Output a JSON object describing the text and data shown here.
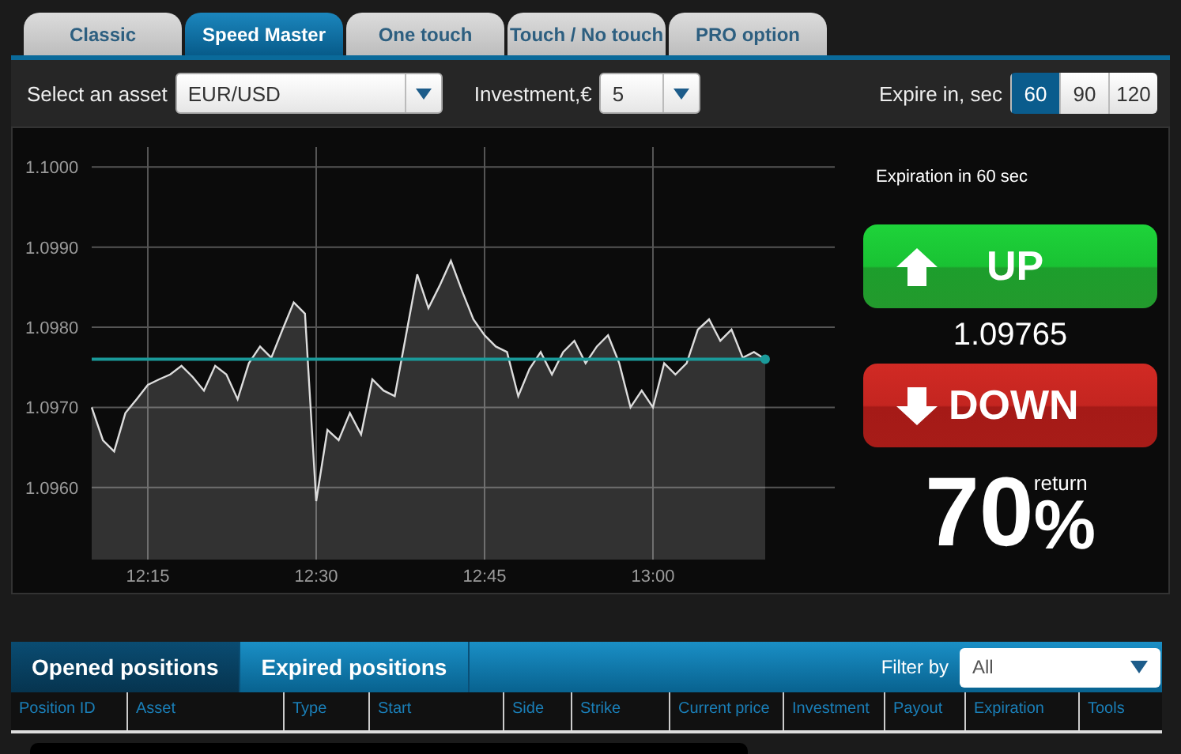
{
  "tabs": [
    {
      "label": "Classic",
      "selected": false
    },
    {
      "label": "Speed Master",
      "selected": true
    },
    {
      "label": "One touch",
      "selected": false
    },
    {
      "label": "Touch / No touch",
      "selected": false
    },
    {
      "label": "PRO option",
      "selected": false
    }
  ],
  "toolbar": {
    "asset": {
      "label": "Select an asset",
      "value": "EUR/USD"
    },
    "investment": {
      "label": "Investment,€",
      "value": "5"
    },
    "expire": {
      "label": "Expire in, sec",
      "options": [
        {
          "label": "60",
          "selected": true
        },
        {
          "label": "90",
          "selected": false
        },
        {
          "label": "120",
          "selected": false
        }
      ]
    }
  },
  "chart": {
    "chart_data": {
      "type": "area",
      "categories": [
        null,
        null,
        null,
        null,
        null,
        "12:15",
        null,
        null,
        null,
        null,
        null,
        null,
        null,
        null,
        null,
        null,
        null,
        null,
        null,
        null,
        "12:30",
        null,
        null,
        null,
        null,
        null,
        null,
        null,
        null,
        null,
        null,
        null,
        null,
        null,
        null,
        "12:45",
        null,
        null,
        null,
        null,
        null,
        null,
        null,
        null,
        null,
        null,
        null,
        null,
        null,
        null,
        "13:00",
        null,
        null,
        null,
        null,
        null,
        null,
        null,
        null,
        null,
        null
      ],
      "series": [
        {
          "color": "#dddddd",
          "values": [
            1.097,
            1.09659,
            1.09645,
            1.09693,
            1.0971,
            1.09728,
            1.09735,
            1.09741,
            1.09752,
            1.09738,
            1.09721,
            1.09752,
            1.09741,
            1.0971,
            1.09755,
            1.09776,
            1.09762,
            1.09797,
            1.09831,
            1.09817,
            1.09583,
            1.09672,
            1.09659,
            1.09693,
            1.09666,
            1.09735,
            1.09721,
            1.09714,
            1.0979,
            1.09866,
            1.09824,
            1.09852,
            1.09883,
            1.09845,
            1.0981,
            1.0979,
            1.09776,
            1.09769,
            1.09714,
            1.09748,
            1.09769,
            1.09741,
            1.09769,
            1.09783,
            1.09755,
            1.09776,
            1.0979,
            1.09755,
            1.097,
            1.09721,
            1.097,
            1.09755,
            1.09741,
            1.09755,
            1.09797,
            1.0981,
            1.09783,
            1.09797,
            1.09762,
            1.09769,
            1.0976
          ]
        }
      ],
      "ylim": [
        1.0951,
        1.10025
      ],
      "grid": true,
      "yticks": [
        {
          "value": 1.096,
          "label": "1.0960"
        },
        {
          "value": 1.097,
          "label": "1.0970"
        },
        {
          "value": 1.098,
          "label": "1.0980"
        },
        {
          "value": 1.099,
          "label": "1.0990"
        },
        {
          "value": 1.1,
          "label": "1.1000"
        }
      ],
      "ref_lines": [
        {
          "axis": "y",
          "value": 1.0976,
          "color": "#1a9a9a"
        }
      ]
    }
  },
  "trade": {
    "expiration_note": "Expiration in 60 sec",
    "up_button": "UP",
    "price": "1.09765",
    "down_button": "DOWN",
    "payout": "70",
    "percent": "%",
    "return_label": "return"
  },
  "positions": {
    "tabs": [
      {
        "label": "Opened positions",
        "selected": true
      },
      {
        "label": "Expired positions",
        "selected": false
      }
    ],
    "filter": {
      "label": "Filter by",
      "value": "All"
    },
    "columns": [
      "Position ID",
      "Asset",
      "Type",
      "Start",
      "Side",
      "Strike",
      "Current price",
      "Investment",
      "Payout",
      "Expiration",
      "Tools"
    ]
  }
}
